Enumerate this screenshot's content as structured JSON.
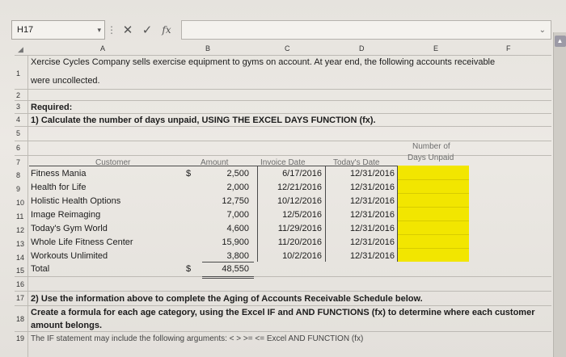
{
  "formula_bar": {
    "cell_ref": "H17",
    "cancel_glyph": "✕",
    "enter_glyph": "✓",
    "fx_glyph": "fx",
    "formula_value": ""
  },
  "columns": [
    "A",
    "B",
    "C",
    "D",
    "E",
    "F"
  ],
  "sheet": {
    "row1_line1": "Xercise Cycles Company sells exercise equipment to gyms on account. At year end, the following accounts receivable",
    "row1_line2": "were uncollected.",
    "row3": "Required:",
    "row4": "1) Calculate the number of days unpaid, USING THE EXCEL DAYS FUNCTION (fx).",
    "headers": {
      "customer": "Customer",
      "amount": "Amount",
      "invoice_date": "Invoice Date",
      "todays_date": "Today's Date",
      "days_unpaid_1": "Number of",
      "days_unpaid_2": "Days Unpaid"
    },
    "dollar": "$",
    "rows": [
      {
        "num": "8",
        "customer": "Fitness Mania",
        "dollar": "$",
        "amount": "2,500",
        "invoice": "6/17/2016",
        "today": "12/31/2016"
      },
      {
        "num": "9",
        "customer": "Health for Life",
        "dollar": "",
        "amount": "2,000",
        "invoice": "12/21/2016",
        "today": "12/31/2016"
      },
      {
        "num": "10",
        "customer": "Holistic Health Options",
        "dollar": "",
        "amount": "12,750",
        "invoice": "10/12/2016",
        "today": "12/31/2016"
      },
      {
        "num": "11",
        "customer": "Image Reimaging",
        "dollar": "",
        "amount": "7,000",
        "invoice": "12/5/2016",
        "today": "12/31/2016"
      },
      {
        "num": "12",
        "customer": "Today's Gym World",
        "dollar": "",
        "amount": "4,600",
        "invoice": "11/29/2016",
        "today": "12/31/2016"
      },
      {
        "num": "13",
        "customer": "Whole Life Fitness Center",
        "dollar": "",
        "amount": "15,900",
        "invoice": "11/20/2016",
        "today": "12/31/2016"
      },
      {
        "num": "14",
        "customer": "Workouts Unlimited",
        "dollar": "",
        "amount": "3,800",
        "invoice": "10/2/2016",
        "today": "12/31/2016"
      }
    ],
    "total_label": "Total",
    "total_dollar": "$",
    "total_amount": "48,550",
    "row17": "2) Use the information above to complete the Aging of Accounts Receivable Schedule below.",
    "row18_line1": "Create a formula for each age category, using the Excel IF and AND FUNCTIONS (fx) to determine where each customer",
    "row18_line2": "amount belongs.",
    "row19": "The IF statement may include the following arguments: < > >= <= Excel AND FUNCTION (fx)"
  },
  "row_numbers": [
    "1",
    "2",
    "3",
    "4",
    "5",
    "6",
    "7",
    "8",
    "9",
    "10",
    "11",
    "12",
    "13",
    "14",
    "15",
    "16",
    "17",
    "18",
    "19"
  ],
  "colors": {
    "highlight": "#f2e600",
    "header_text": "#6d6d6d"
  }
}
